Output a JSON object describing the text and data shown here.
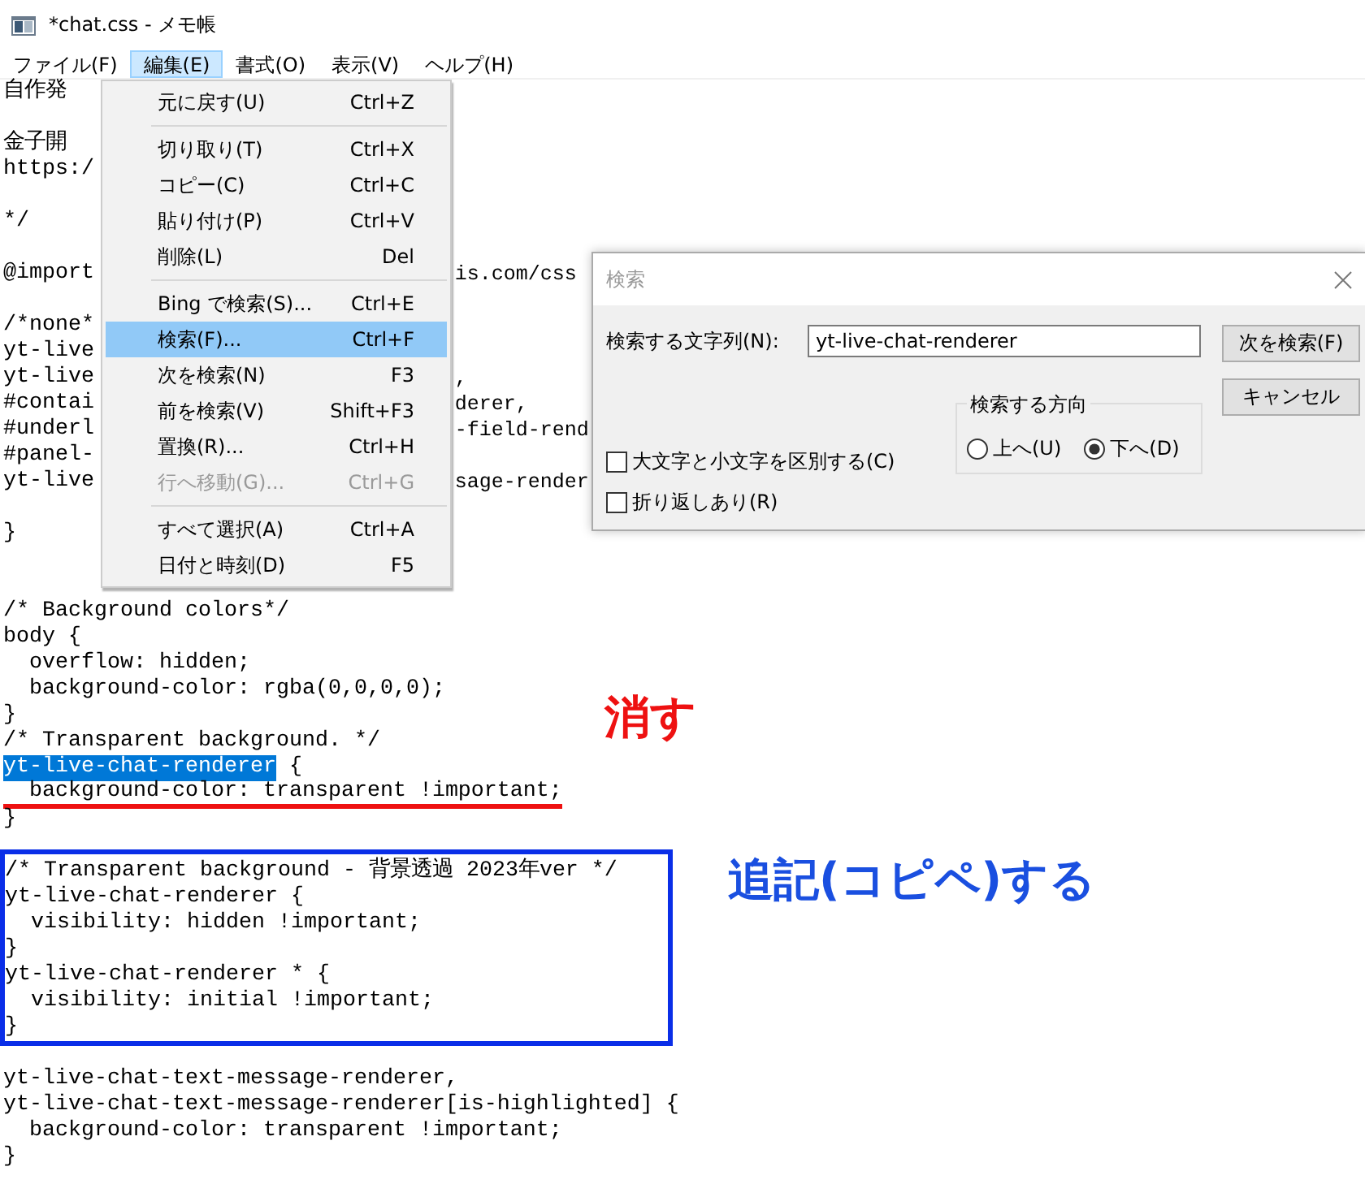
{
  "window": {
    "title": "*chat.css - メモ帳"
  },
  "menubar": [
    {
      "label": "ファイル(F)",
      "selected": false
    },
    {
      "label": "編集(E)",
      "selected": true
    },
    {
      "label": "書式(O)",
      "selected": false
    },
    {
      "label": "表示(V)",
      "selected": false
    },
    {
      "label": "ヘルプ(H)",
      "selected": false
    }
  ],
  "editor": {
    "lines": [
      {
        "kind": "text",
        "text": "自作発"
      },
      {
        "kind": "blank"
      },
      {
        "kind": "text",
        "text": "金子開"
      },
      {
        "kind": "text",
        "text": "https:/"
      },
      {
        "kind": "blank"
      },
      {
        "kind": "text",
        "text": "*/"
      },
      {
        "kind": "blank"
      },
      {
        "kind": "text",
        "text": "@import",
        "text_right": "is.com/css"
      },
      {
        "kind": "blank"
      },
      {
        "kind": "text",
        "text": "/*none*"
      },
      {
        "kind": "text",
        "text": "yt-live"
      },
      {
        "kind": "text",
        "text": "yt-live",
        "text_right": ","
      },
      {
        "kind": "text",
        "text": "#contai",
        "text_right": "derer,"
      },
      {
        "kind": "text",
        "text": "#underl",
        "text_right": "-field-rend"
      },
      {
        "kind": "text",
        "text": "#panel-"
      },
      {
        "kind": "text",
        "text": "yt-live",
        "text_right": "sage-render"
      },
      {
        "kind": "blank"
      },
      {
        "kind": "text",
        "text": "}"
      },
      {
        "kind": "blank"
      },
      {
        "kind": "blank"
      },
      {
        "kind": "text",
        "text": "/* Background colors*/"
      },
      {
        "kind": "text",
        "text": "body {"
      },
      {
        "kind": "text",
        "text": "  overflow: hidden;"
      },
      {
        "kind": "text",
        "text": "  background-color: rgba(0,0,0,0);"
      },
      {
        "kind": "text",
        "text": "}"
      },
      {
        "kind": "text",
        "text": "/* Transparent background. */"
      },
      {
        "kind": "selected",
        "selection": "yt-live-chat-renderer",
        "text": " {"
      },
      {
        "kind": "underlined",
        "text": "  background-color: transparent !important;"
      },
      {
        "kind": "text",
        "text": "}"
      },
      {
        "kind": "blank"
      },
      {
        "kind": "boxed",
        "lines": [
          "/* Transparent background - 背景透過 2023年ver */",
          "yt-live-chat-renderer {",
          "  visibility: hidden !important;",
          "}",
          "yt-live-chat-renderer * {",
          "  visibility: initial !important;",
          "}"
        ]
      },
      {
        "kind": "blank"
      },
      {
        "kind": "text",
        "text": "yt-live-chat-text-message-renderer,"
      },
      {
        "kind": "text",
        "text": "yt-live-chat-text-message-renderer[is-highlighted] {"
      },
      {
        "kind": "text",
        "text": "  background-color: transparent !important;"
      },
      {
        "kind": "text",
        "text": "}"
      }
    ]
  },
  "edit_menu": {
    "groups": [
      {
        "items": [
          {
            "label": "元に戻す(U)",
            "shortcut": "Ctrl+Z",
            "selected": false,
            "disabled": false
          }
        ]
      },
      {
        "items": [
          {
            "label": "切り取り(T)",
            "shortcut": "Ctrl+X",
            "selected": false,
            "disabled": false
          },
          {
            "label": "コピー(C)",
            "shortcut": "Ctrl+C",
            "selected": false,
            "disabled": false
          },
          {
            "label": "貼り付け(P)",
            "shortcut": "Ctrl+V",
            "selected": false,
            "disabled": false
          },
          {
            "label": "削除(L)",
            "shortcut": "Del",
            "selected": false,
            "disabled": false
          }
        ]
      },
      {
        "items": [
          {
            "label": "Bing で検索(S)...",
            "shortcut": "Ctrl+E",
            "selected": false,
            "disabled": false
          },
          {
            "label": "検索(F)...",
            "shortcut": "Ctrl+F",
            "selected": true,
            "disabled": false
          },
          {
            "label": "次を検索(N)",
            "shortcut": "F3",
            "selected": false,
            "disabled": false
          },
          {
            "label": "前を検索(V)",
            "shortcut": "Shift+F3",
            "selected": false,
            "disabled": false
          },
          {
            "label": "置換(R)...",
            "shortcut": "Ctrl+H",
            "selected": false,
            "disabled": false
          },
          {
            "label": "行へ移動(G)...",
            "shortcut": "Ctrl+G",
            "selected": false,
            "disabled": true
          }
        ]
      },
      {
        "items": [
          {
            "label": "すべて選択(A)",
            "shortcut": "Ctrl+A",
            "selected": false,
            "disabled": false
          },
          {
            "label": "日付と時刻(D)",
            "shortcut": "F5",
            "selected": false,
            "disabled": false
          }
        ]
      }
    ]
  },
  "find_dialog": {
    "title": "検索",
    "field_label": "検索する文字列(N):",
    "value": "yt-live-chat-renderer",
    "buttons": [
      "次を検索(F)",
      "キャンセル"
    ],
    "direction_label": "検索する方向",
    "radios": [
      {
        "label": "上へ(U)",
        "selected": false
      },
      {
        "label": "下へ(D)",
        "selected": true
      }
    ],
    "checkboxes": [
      {
        "label": "大文字と小文字を区別する(C)",
        "checked": false
      },
      {
        "label": "折り返しあり(R)",
        "checked": false
      }
    ]
  },
  "annotations": [
    {
      "text": "消す",
      "color": "#ee1111"
    },
    {
      "text": "追記(コピペ)する",
      "color": "#1a4fe0"
    }
  ]
}
